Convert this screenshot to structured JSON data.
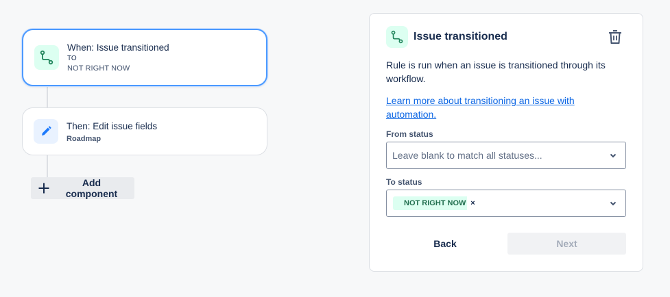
{
  "flow": {
    "trigger": {
      "title": "When: Issue transitioned",
      "direction": "TO",
      "status": "NOT RIGHT NOW",
      "icon": "transition-icon"
    },
    "action": {
      "title": "Then: Edit issue fields",
      "subtitle": "Roadmap",
      "icon": "pencil-icon"
    },
    "add_component_label": "Add component"
  },
  "panel": {
    "title": "Issue transitioned",
    "icon": "transition-icon",
    "delete_icon": "trash-icon",
    "description": "Rule is run when an issue is transitioned through its workflow.",
    "learn_more": "Learn more about transitioning an issue with automation.",
    "from_status": {
      "label": "From status",
      "placeholder": "Leave blank to match all statuses..."
    },
    "to_status": {
      "label": "To status",
      "selected": [
        "NOT RIGHT NOW"
      ],
      "remove_glyph": "×"
    },
    "back_label": "Back",
    "next_label": "Next"
  },
  "colors": {
    "accent": "#4c9aff",
    "link": "#0c66e4",
    "trigger_icon_bg": "#dcfff1",
    "action_icon_bg": "#e9f2ff",
    "tag_bg": "#dcfff1",
    "tag_text": "#216e4e"
  }
}
